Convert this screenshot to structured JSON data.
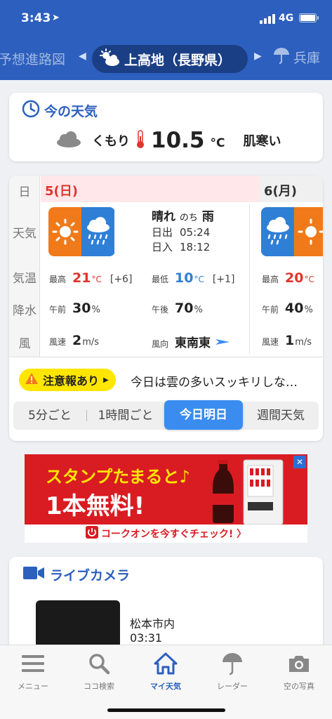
{
  "status_bar": {
    "time": "3:43",
    "location_arrow": "➤",
    "network": "4G"
  },
  "header": {
    "prev_tab": "予想進路図",
    "current_location": "上高地（長野県）",
    "next_tab": "兵庫",
    "icons": {
      "current": "cloud-sun-icon",
      "next": "umbrella-icon"
    }
  },
  "current_weather": {
    "title": "今の天気",
    "condition": "くもり",
    "temperature": "10.5",
    "unit": "°C",
    "feeling": "肌寒い",
    "icons": {
      "title": "clock-icon",
      "condition": "cloud-icon",
      "thermometer": "thermometer-icon"
    }
  },
  "forecast": {
    "row_labels": [
      "日",
      "天気",
      "気温",
      "降水",
      "風"
    ],
    "day1": {
      "date": "5(日)",
      "weather": "晴れ",
      "weather_connector": "のち",
      "weather_after": "雨",
      "sunrise_label": "日出",
      "sunrise": "05:24",
      "sunset_label": "日入",
      "sunset": "18:12",
      "max_label": "最高",
      "max_temp": "21",
      "max_diff": "[+6]",
      "min_label": "最低",
      "min_temp": "10",
      "min_diff": "[+1]",
      "am_label": "午前",
      "precip_am": "30",
      "pm_label": "午後",
      "precip_pm": "70",
      "wind_speed_label": "風速",
      "wind_speed": "2",
      "wind_dir_label": "風向",
      "wind_dir": "東南東",
      "temp_unit": "°C",
      "precip_unit": "%",
      "wind_unit": "m/s"
    },
    "day2": {
      "date": "6(月)",
      "max_label": "最高",
      "max_temp": "20",
      "am_label": "午前",
      "precip_am": "40",
      "wind_speed_label": "風速",
      "wind_speed": "1",
      "temp_unit": "°C",
      "precip_unit": "%",
      "wind_unit": "m/s"
    },
    "alert": {
      "label": "注意報あり",
      "summary": "今日は雲の多いスッキリしな…"
    },
    "tabs": [
      "5分ごと",
      "1時間ごと",
      "今日明日",
      "週間天気"
    ],
    "active_tab": "今日明日"
  },
  "ad": {
    "line1": "スタンプたまると♪",
    "line2": "1本無料!",
    "cta": "コークオンを今すぐチェック! 〉",
    "close": "✕"
  },
  "live_camera": {
    "title": "ライブカメラ",
    "place": "松本市内",
    "time": "03:31"
  },
  "bottom_nav": [
    {
      "label": "メニュー",
      "icon": "menu-icon"
    },
    {
      "label": "ココ検索",
      "icon": "search-icon"
    },
    {
      "label": "マイ天気",
      "icon": "home-icon"
    },
    {
      "label": "レーダー",
      "icon": "umbrella-icon"
    },
    {
      "label": "空の写真",
      "icon": "camera-icon"
    }
  ],
  "colors": {
    "brand_blue": "#2c5fbe",
    "tab_active": "#3a8cf0",
    "sunday_red": "#e0342d",
    "alert_yellow": "#ffe600",
    "ad_red": "#d91c22"
  }
}
